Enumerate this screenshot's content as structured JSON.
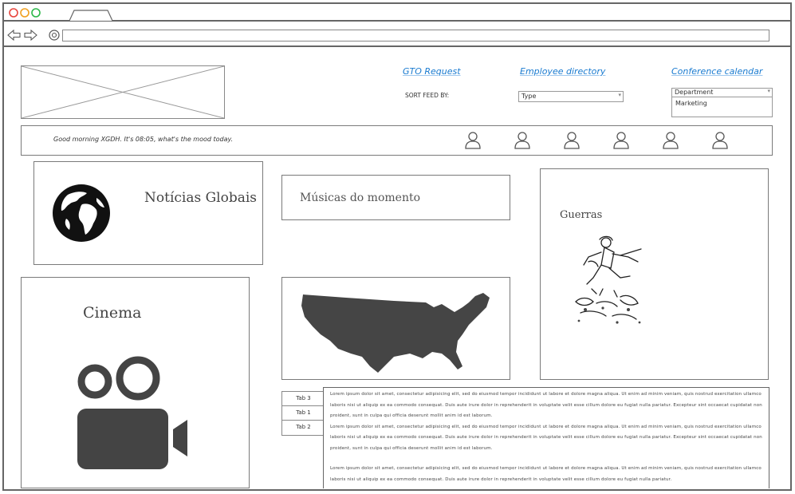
{
  "browser": {
    "traffic_lights": [
      "#e7453d",
      "#f0a020",
      "#2db84a"
    ]
  },
  "header": {
    "links": {
      "gto_request": "GTO Request",
      "employee_directory": "Employee directory",
      "conference_calendar": "Conference calendar"
    },
    "sort_label": "SORT FEED BY:",
    "type_select": "Type",
    "department_select": "Department",
    "department_list_item": "Marketing"
  },
  "greeting": "Good morning XGDH. It's 08:05, what's the mood today.",
  "mood_icons": [
    "user-icon",
    "user-icon",
    "user-icon",
    "user-icon",
    "user-icon",
    "user-icon"
  ],
  "cards": {
    "noticias": "Notícias Globais",
    "musicas": "Músicas do momento",
    "guerras": "Guerras",
    "cinema": "Cinema"
  },
  "tabs": [
    "Tab 3",
    "Tab 1",
    "Tab 2"
  ],
  "lorem_paragraphs": [
    "Lorem ipsum dolor sit amet, consectetur adipisicing elit, sed do eiusmod tempor incididunt ut labore et dolore magna aliqua. Ut enim ad minim veniam, quis nostrud exercitation ullamco laboris nisi ut aliquip ex ea commodo consequat. Duis aute irure dolor in reprehenderit in voluptate velit esse cillum dolore eu fugiat nulla pariatur. Excepteur sint occaecat cupidatat non proident, sunt in culpa qui officia deserunt mollit anim id est laborum.",
    "Lorem ipsum dolor sit amet, consectetur adipisicing elit, sed do eiusmod tempor incididunt ut labore et dolore magna aliqua. Ut enim ad minim veniam, quis nostrud exercitation ullamco laboris nisi ut aliquip ex ea commodo consequat. Duis aute irure dolor in reprehenderit in voluptate velit esse cillum dolore eu fugiat nulla pariatur. Excepteur sint occaecat cupidatat non proident, sunt in culpa qui officia deserunt mollit anim id est laborum.",
    "Lorem ipsum dolor sit amet, consectetur adipisicing elit, sed do eiusmod tempor incididunt ut labore et dolore magna aliqua. Ut enim ad minim veniam, quis nostrud exercitation ullamco laboris nisi ut aliquip ex ea commodo consequat. Duis aute irure dolor in reprehenderit in voluptate velit esse cillum dolore eu fugiat nulla pariatur."
  ]
}
